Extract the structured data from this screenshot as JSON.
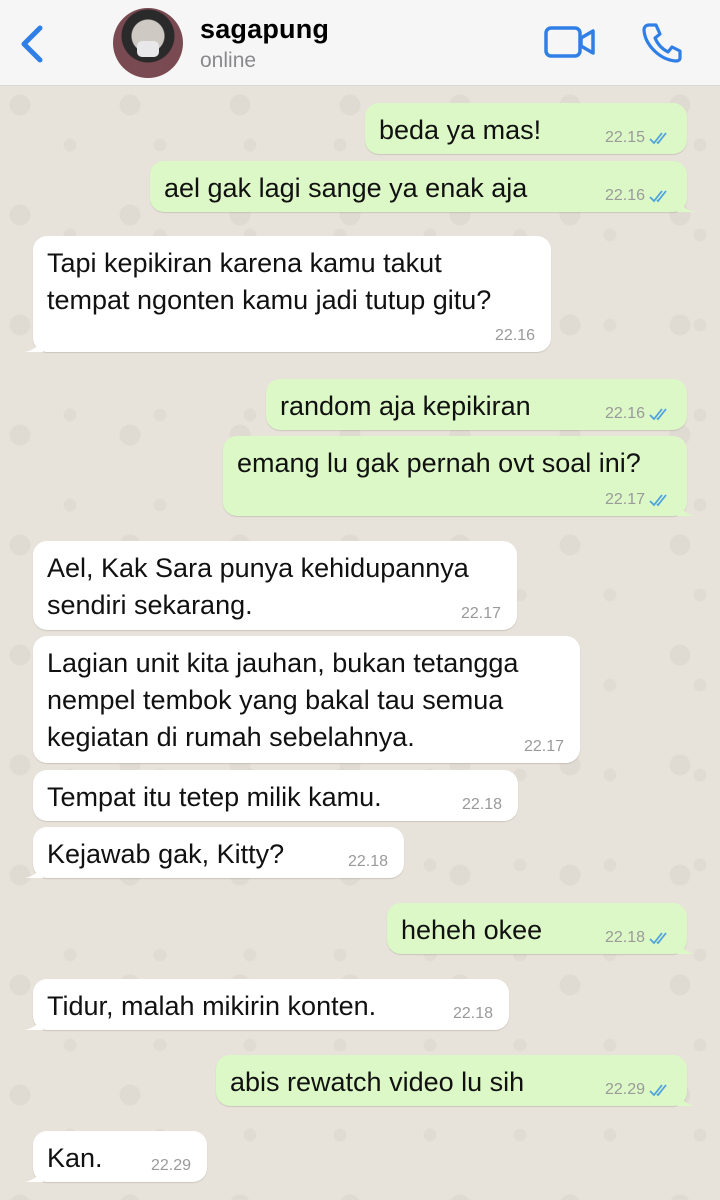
{
  "header": {
    "contact_name": "sagapung",
    "status": "online"
  },
  "colors": {
    "accent": "#2f7fe6",
    "outgoing_bubble": "#dcf8c6",
    "incoming_bubble": "#ffffff",
    "read_ticks": "#4fa3e0"
  },
  "icons": [
    "chevron-left-icon",
    "video-call-icon",
    "phone-icon",
    "double-check-icon"
  ],
  "messages": [
    {
      "dir": "out",
      "text": "beda ya mas!",
      "time": "22.15",
      "read": true
    },
    {
      "dir": "out",
      "text": "ael gak lagi sange ya enak aja",
      "time": "22.16",
      "read": true
    },
    {
      "dir": "in",
      "text": "Tapi kepikiran karena kamu takut\ntempat ngonten kamu jadi tutup gitu?",
      "time": "22.16"
    },
    {
      "dir": "out",
      "text": "random aja kepikiran",
      "time": "22.16",
      "read": true
    },
    {
      "dir": "out",
      "text": "emang lu gak pernah ovt soal ini?",
      "time": "22.17",
      "read": true
    },
    {
      "dir": "in",
      "text": "Ael, Kak Sara punya kehidupannya\nsendiri sekarang.",
      "time": "22.17"
    },
    {
      "dir": "in",
      "text": "Lagian unit kita jauhan, bukan tetangga\nnempel tembok yang bakal tau semua\nkegiatan di rumah sebelahnya.",
      "time": "22.17"
    },
    {
      "dir": "in",
      "text": "Tempat itu tetep milik kamu.",
      "time": "22.18"
    },
    {
      "dir": "in",
      "text": "Kejawab gak, Kitty?",
      "time": "22.18"
    },
    {
      "dir": "out",
      "text": "heheh okee",
      "time": "22.18",
      "read": true
    },
    {
      "dir": "in",
      "text": "Tidur, malah mikirin konten.",
      "time": "22.18"
    },
    {
      "dir": "out",
      "text": "abis rewatch video lu sih",
      "time": "22.29",
      "read": true
    },
    {
      "dir": "in",
      "text": "Kan.",
      "time": "22.29"
    }
  ]
}
